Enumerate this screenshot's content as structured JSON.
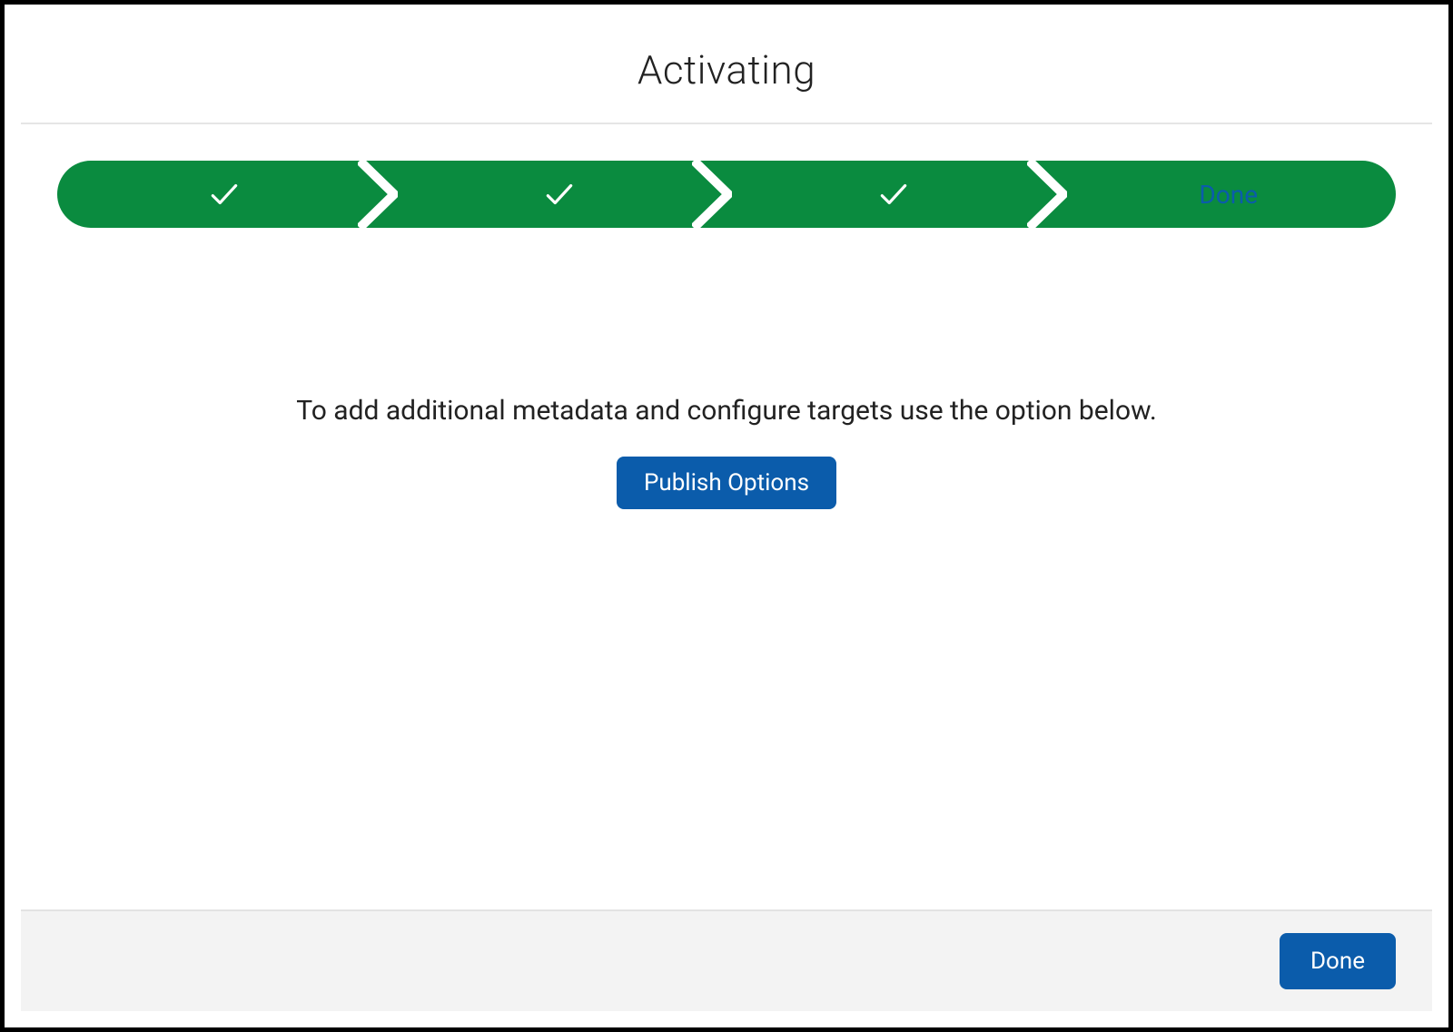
{
  "header": {
    "title": "Activating"
  },
  "progress": {
    "steps": [
      {
        "state": "complete",
        "label": ""
      },
      {
        "state": "complete",
        "label": ""
      },
      {
        "state": "complete",
        "label": ""
      },
      {
        "state": "current",
        "label": "Done"
      }
    ]
  },
  "body": {
    "instruction": "To add additional metadata and configure targets use the option below.",
    "publish_button_label": "Publish Options"
  },
  "footer": {
    "done_button_label": "Done"
  },
  "colors": {
    "progress_green": "#0a8b3f",
    "primary_blue": "#0b5cab"
  }
}
